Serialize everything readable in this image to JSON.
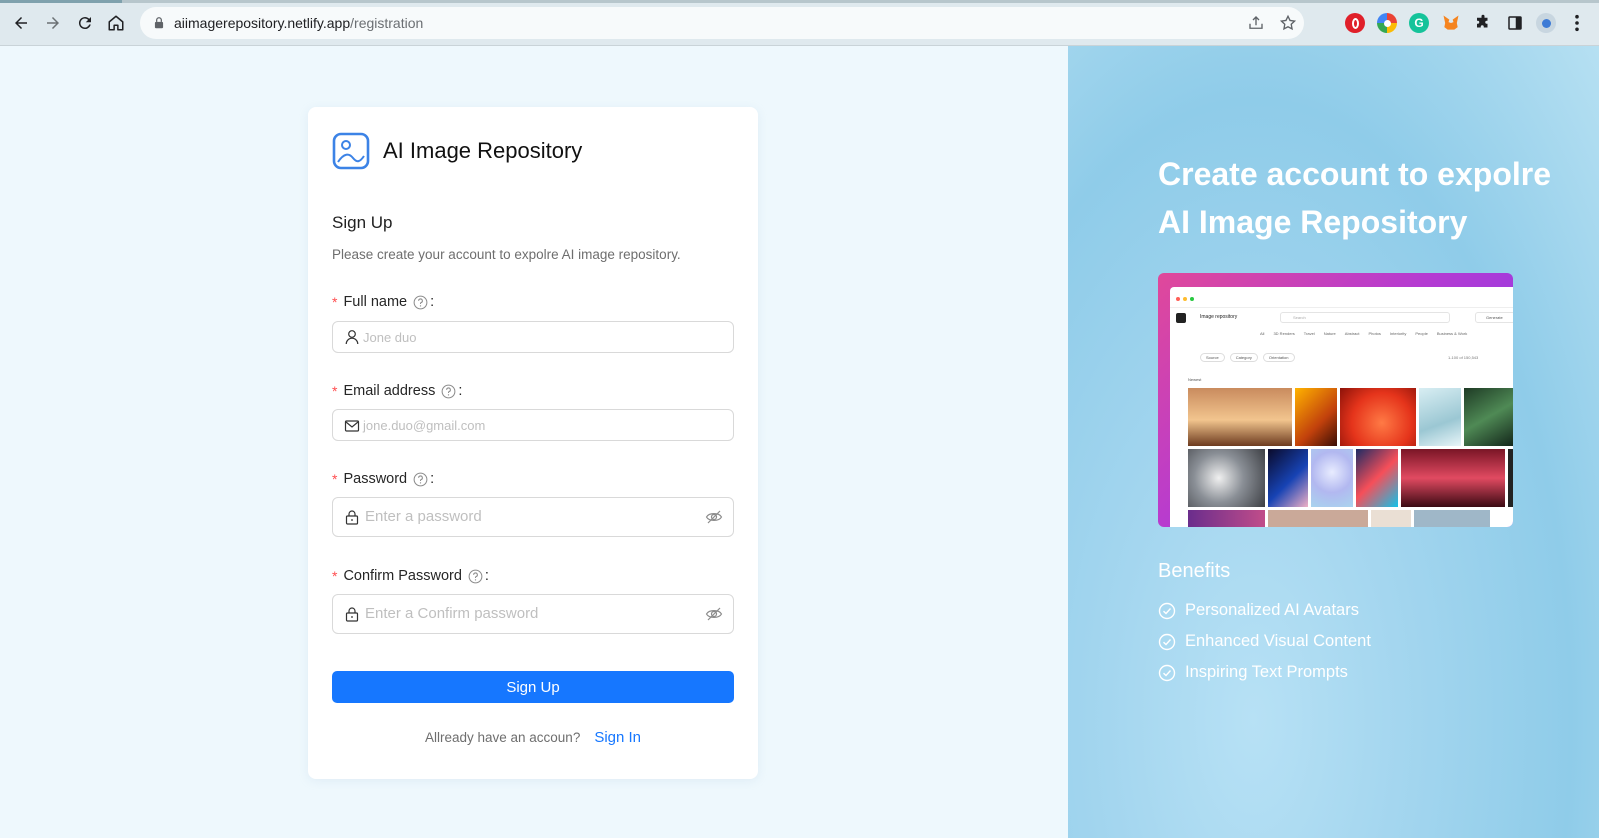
{
  "browser": {
    "url_host": "aiimagerepository.netlify.app",
    "url_path": "/registration"
  },
  "card": {
    "app_title": "AI Image Repository",
    "heading": "Sign Up",
    "subheading": "Please create your account to expolre AI image repository.",
    "fields": [
      {
        "label": "Full name",
        "placeholder": "Jone duo"
      },
      {
        "label": "Email address",
        "placeholder": "jone.duo@gmail.com"
      },
      {
        "label": "Password",
        "placeholder": "Enter a password"
      },
      {
        "label": "Confirm Password",
        "placeholder": "Enter a Confirm password"
      }
    ],
    "label_suffix": ":",
    "required_mark": "*",
    "submit_label": "Sign Up",
    "have_account_text": "Allready have an accoun?",
    "signin_link": "Sign In"
  },
  "hero": {
    "title_line1": "Create account to expolre",
    "title_line2": "AI Image Repository",
    "benefits_title": "Benefits",
    "benefits": [
      "Personalized AI Avatars",
      "Enhanced Visual Content",
      "Inspiring Text Prompts"
    ]
  },
  "preview": {
    "app_name": "Image repository",
    "search_placeholder": "Search",
    "button_label": "Generate",
    "category_tabs": [
      "All",
      "3D Renders",
      "Travel",
      "Nature",
      "Abstract",
      "Photos",
      "Interiority",
      "People",
      "Business & Work"
    ],
    "filters": [
      "Source",
      "Category",
      "Orientation"
    ],
    "count_text": "1-100 of 150,543",
    "section_label": "Newest"
  },
  "colors": {
    "primary": "#1677ff",
    "required": "#ff4d4f",
    "page_bg": "#eef8fd",
    "panel_bg": "#8fcce9"
  },
  "icons": [
    "lock-icon",
    "back-arrow-icon",
    "forward-arrow-icon",
    "reload-icon",
    "home-icon",
    "share-icon",
    "star-icon",
    "puzzle-icon",
    "sidebar-icon",
    "profile-icon",
    "menu-icon",
    "image-logo-icon",
    "help-icon",
    "user-icon",
    "mail-icon",
    "password-lock-icon",
    "eye-invisible-icon",
    "check-circle-icon"
  ]
}
